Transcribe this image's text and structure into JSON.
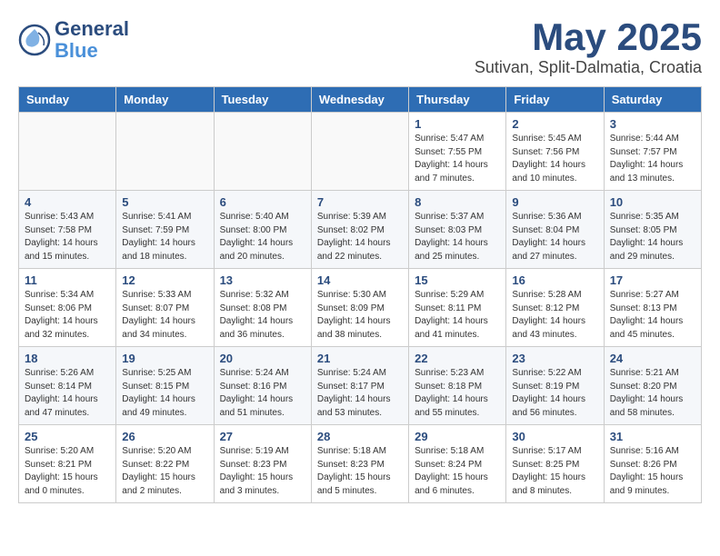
{
  "header": {
    "logo_general": "General",
    "logo_blue": "Blue",
    "title": "May 2025",
    "location": "Sutivan, Split-Dalmatia, Croatia"
  },
  "weekdays": [
    "Sunday",
    "Monday",
    "Tuesday",
    "Wednesday",
    "Thursday",
    "Friday",
    "Saturday"
  ],
  "weeks": [
    [
      {
        "day": "",
        "info": ""
      },
      {
        "day": "",
        "info": ""
      },
      {
        "day": "",
        "info": ""
      },
      {
        "day": "",
        "info": ""
      },
      {
        "day": "1",
        "info": "Sunrise: 5:47 AM\nSunset: 7:55 PM\nDaylight: 14 hours\nand 7 minutes."
      },
      {
        "day": "2",
        "info": "Sunrise: 5:45 AM\nSunset: 7:56 PM\nDaylight: 14 hours\nand 10 minutes."
      },
      {
        "day": "3",
        "info": "Sunrise: 5:44 AM\nSunset: 7:57 PM\nDaylight: 14 hours\nand 13 minutes."
      }
    ],
    [
      {
        "day": "4",
        "info": "Sunrise: 5:43 AM\nSunset: 7:58 PM\nDaylight: 14 hours\nand 15 minutes."
      },
      {
        "day": "5",
        "info": "Sunrise: 5:41 AM\nSunset: 7:59 PM\nDaylight: 14 hours\nand 18 minutes."
      },
      {
        "day": "6",
        "info": "Sunrise: 5:40 AM\nSunset: 8:00 PM\nDaylight: 14 hours\nand 20 minutes."
      },
      {
        "day": "7",
        "info": "Sunrise: 5:39 AM\nSunset: 8:02 PM\nDaylight: 14 hours\nand 22 minutes."
      },
      {
        "day": "8",
        "info": "Sunrise: 5:37 AM\nSunset: 8:03 PM\nDaylight: 14 hours\nand 25 minutes."
      },
      {
        "day": "9",
        "info": "Sunrise: 5:36 AM\nSunset: 8:04 PM\nDaylight: 14 hours\nand 27 minutes."
      },
      {
        "day": "10",
        "info": "Sunrise: 5:35 AM\nSunset: 8:05 PM\nDaylight: 14 hours\nand 29 minutes."
      }
    ],
    [
      {
        "day": "11",
        "info": "Sunrise: 5:34 AM\nSunset: 8:06 PM\nDaylight: 14 hours\nand 32 minutes."
      },
      {
        "day": "12",
        "info": "Sunrise: 5:33 AM\nSunset: 8:07 PM\nDaylight: 14 hours\nand 34 minutes."
      },
      {
        "day": "13",
        "info": "Sunrise: 5:32 AM\nSunset: 8:08 PM\nDaylight: 14 hours\nand 36 minutes."
      },
      {
        "day": "14",
        "info": "Sunrise: 5:30 AM\nSunset: 8:09 PM\nDaylight: 14 hours\nand 38 minutes."
      },
      {
        "day": "15",
        "info": "Sunrise: 5:29 AM\nSunset: 8:11 PM\nDaylight: 14 hours\nand 41 minutes."
      },
      {
        "day": "16",
        "info": "Sunrise: 5:28 AM\nSunset: 8:12 PM\nDaylight: 14 hours\nand 43 minutes."
      },
      {
        "day": "17",
        "info": "Sunrise: 5:27 AM\nSunset: 8:13 PM\nDaylight: 14 hours\nand 45 minutes."
      }
    ],
    [
      {
        "day": "18",
        "info": "Sunrise: 5:26 AM\nSunset: 8:14 PM\nDaylight: 14 hours\nand 47 minutes."
      },
      {
        "day": "19",
        "info": "Sunrise: 5:25 AM\nSunset: 8:15 PM\nDaylight: 14 hours\nand 49 minutes."
      },
      {
        "day": "20",
        "info": "Sunrise: 5:24 AM\nSunset: 8:16 PM\nDaylight: 14 hours\nand 51 minutes."
      },
      {
        "day": "21",
        "info": "Sunrise: 5:24 AM\nSunset: 8:17 PM\nDaylight: 14 hours\nand 53 minutes."
      },
      {
        "day": "22",
        "info": "Sunrise: 5:23 AM\nSunset: 8:18 PM\nDaylight: 14 hours\nand 55 minutes."
      },
      {
        "day": "23",
        "info": "Sunrise: 5:22 AM\nSunset: 8:19 PM\nDaylight: 14 hours\nand 56 minutes."
      },
      {
        "day": "24",
        "info": "Sunrise: 5:21 AM\nSunset: 8:20 PM\nDaylight: 14 hours\nand 58 minutes."
      }
    ],
    [
      {
        "day": "25",
        "info": "Sunrise: 5:20 AM\nSunset: 8:21 PM\nDaylight: 15 hours\nand 0 minutes."
      },
      {
        "day": "26",
        "info": "Sunrise: 5:20 AM\nSunset: 8:22 PM\nDaylight: 15 hours\nand 2 minutes."
      },
      {
        "day": "27",
        "info": "Sunrise: 5:19 AM\nSunset: 8:23 PM\nDaylight: 15 hours\nand 3 minutes."
      },
      {
        "day": "28",
        "info": "Sunrise: 5:18 AM\nSunset: 8:23 PM\nDaylight: 15 hours\nand 5 minutes."
      },
      {
        "day": "29",
        "info": "Sunrise: 5:18 AM\nSunset: 8:24 PM\nDaylight: 15 hours\nand 6 minutes."
      },
      {
        "day": "30",
        "info": "Sunrise: 5:17 AM\nSunset: 8:25 PM\nDaylight: 15 hours\nand 8 minutes."
      },
      {
        "day": "31",
        "info": "Sunrise: 5:16 AM\nSunset: 8:26 PM\nDaylight: 15 hours\nand 9 minutes."
      }
    ]
  ]
}
